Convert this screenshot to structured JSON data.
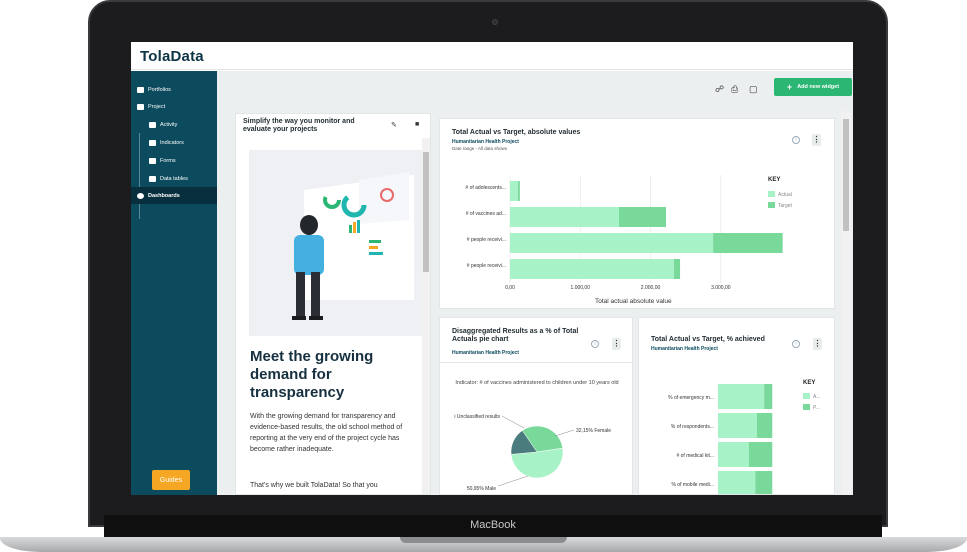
{
  "device": {
    "label": "MacBook"
  },
  "app": {
    "logo": "TolaData"
  },
  "sidebar": {
    "items": [
      {
        "label": "Portfolios",
        "icon": "briefcase-icon"
      },
      {
        "label": "Project",
        "icon": "grid-icon"
      },
      {
        "label": "Activity",
        "icon": "list-icon"
      },
      {
        "label": "Indicators",
        "icon": "bar-chart-icon"
      },
      {
        "label": "Forms",
        "icon": "form-icon"
      },
      {
        "label": "Data tables",
        "icon": "table-icon"
      },
      {
        "label": "Dashboards",
        "icon": "dashboard-icon"
      }
    ],
    "guides_label": "Guides"
  },
  "toolbar": {
    "add_widget_label": "Add new widget",
    "icons": [
      "share-icon",
      "print-icon",
      "trash-icon"
    ]
  },
  "promo_card": {
    "title": "Simplify the way you monitor and evaluate your projects",
    "heading": "Meet the growing demand for transparency",
    "body": "With the growing demand for transparency and evidence-based results, the old school method of reporting at the very end of the project cycle has become rather inadequate.",
    "more": "That's why we built TolaData! So that you"
  },
  "widget_absolute": {
    "title": "Total Actual vs Target, absolute values",
    "project": "Humanitarian Health Project",
    "date_range": "Date range - All data shown",
    "xlabel": "Total actual absolute value",
    "key_title": "KEY"
  },
  "widget_pie": {
    "title": "Disaggregated Results as a % of Total Actuals pie chart",
    "project": "Humanitarian Health Project",
    "indicator": "Indicator: # of vaccines administered to children under 10 years old"
  },
  "widget_percent": {
    "title": "Total Actual vs Target, % achieved",
    "project": "Humanitarian Health Project",
    "key_title": "KEY"
  },
  "colors": {
    "actual": "#a7f2c6",
    "target": "#79d99a",
    "sidebar": "#0c4a5e",
    "accent": "#2bb673",
    "guides": "#f5a623"
  },
  "chart_data": [
    {
      "type": "bar",
      "orientation": "horizontal",
      "title": "Total Actual vs Target, absolute values",
      "categories": [
        "# of adolescents...",
        "# of vaccines ad...",
        "# people receivi...",
        "# people receivi..."
      ],
      "series": [
        {
          "name": "Actual",
          "values": [
            110,
            1550,
            2890,
            2330
          ]
        },
        {
          "name": "Target",
          "values": [
            140,
            2220,
            3880,
            2420
          ]
        }
      ],
      "xlabel": "Total actual absolute value",
      "xticks": [
        "0,00",
        "1.000,00",
        "2.000,00",
        "3.000,00"
      ],
      "xlim": [
        0,
        3700
      ],
      "legend": "top-right"
    },
    {
      "type": "pie",
      "title": "Disaggregated Results as a % of Total Actuals pie chart",
      "labels": [
        "Female",
        "Male",
        "Unclassified results"
      ],
      "label_texts": [
        "32,15% Female",
        "50,95% Male",
        "i Unclassified results"
      ],
      "values": [
        32.15,
        50.95,
        16.9
      ]
    },
    {
      "type": "bar",
      "orientation": "horizontal",
      "title": "Total Actual vs Target, % achieved",
      "categories": [
        "% of emergency m...",
        "% of respondents...",
        "# of medical kit...",
        "% of mobile medi..."
      ],
      "series": [
        {
          "name": "A...",
          "values": [
            57,
            48,
            38,
            46
          ]
        },
        {
          "name": "P...",
          "values": [
            67,
            67,
            67,
            67
          ]
        }
      ],
      "legend": "top-right"
    }
  ]
}
